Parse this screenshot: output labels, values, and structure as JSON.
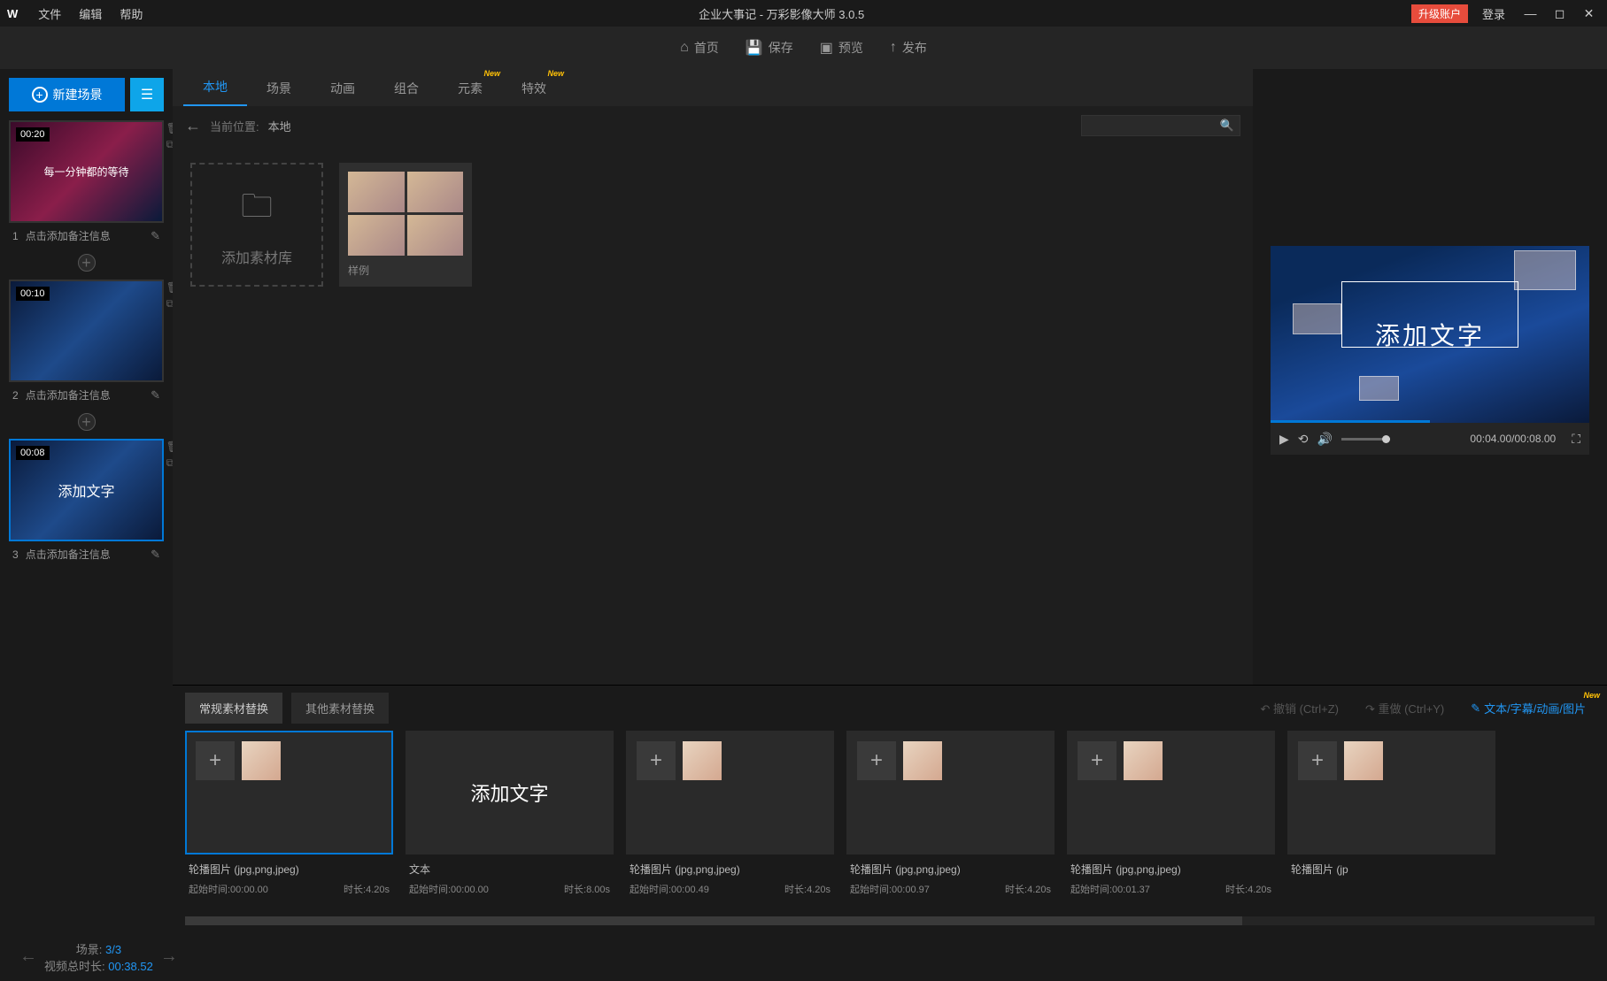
{
  "titlebar": {
    "menu": {
      "file": "文件",
      "edit": "编辑",
      "help": "帮助"
    },
    "title": "企业大事记 - 万彩影像大师 3.0.5",
    "upgrade": "升级账户",
    "login": "登录"
  },
  "toolbar": {
    "home": "首页",
    "save": "保存",
    "preview": "预览",
    "publish": "发布"
  },
  "sidebar": {
    "new_scene": "新建场景",
    "note_placeholder": "点击添加备注信息",
    "scenes": [
      {
        "num": "1",
        "time": "00:20",
        "overlay": "每一分钟都的等待"
      },
      {
        "num": "2",
        "time": "00:10",
        "overlay": ""
      },
      {
        "num": "3",
        "time": "00:08",
        "overlay": "添加文字"
      }
    ]
  },
  "tabs": {
    "local": "本地",
    "scene": "场景",
    "anim": "动画",
    "combo": "组合",
    "element": "元素",
    "effect": "特效",
    "new": "New"
  },
  "breadcrumb": {
    "label": "当前位置:",
    "path": "本地"
  },
  "assets": {
    "add": "添加素材库",
    "sample": "样例"
  },
  "preview": {
    "text": "添加文字",
    "time": "00:04.00/00:08.00"
  },
  "bottom_tabs": {
    "normal": "常规素材替换",
    "other": "其他素材替换",
    "undo": "↶ 撤销 (Ctrl+Z)",
    "redo": "↷ 重做 (Ctrl+Y)",
    "text_link": "文本/字幕/动画/图片",
    "new": "New"
  },
  "clips": [
    {
      "selected": true,
      "type": "sub",
      "title": "轮播图片  (jpg,png,jpeg)",
      "start": "起始时间:00:00.00",
      "dur": "时长:4.20s"
    },
    {
      "selected": false,
      "type": "text",
      "text": "添加文字",
      "title": "文本",
      "start": "起始时间:00:00.00",
      "dur": "时长:8.00s"
    },
    {
      "selected": false,
      "type": "sub",
      "title": "轮播图片  (jpg,png,jpeg)",
      "start": "起始时间:00:00.49",
      "dur": "时长:4.20s"
    },
    {
      "selected": false,
      "type": "sub",
      "title": "轮播图片  (jpg,png,jpeg)",
      "start": "起始时间:00:00.97",
      "dur": "时长:4.20s"
    },
    {
      "selected": false,
      "type": "sub",
      "title": "轮播图片  (jpg,png,jpeg)",
      "start": "起始时间:00:01.37",
      "dur": "时长:4.20s"
    },
    {
      "selected": false,
      "type": "sub",
      "title": "轮播图片  (jp",
      "start": "",
      "dur": ""
    }
  ],
  "status": {
    "scene_label": "场景: ",
    "scene_val": "3/3",
    "total_label": "视频总时长: ",
    "total_val": "00:38.52"
  }
}
